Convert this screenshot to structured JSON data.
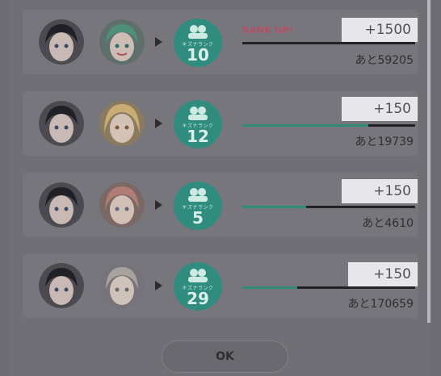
{
  "rows": [
    {
      "rank_up": "RANK UP!",
      "gain": "+1500",
      "remaining": "あと59205",
      "rank_label": "キズナランク",
      "rank": "10",
      "progress": 0.0,
      "partner": "green-hair-character"
    },
    {
      "rank_up": "",
      "gain": "+150",
      "remaining": "あと19739",
      "rank_label": "キズナランク",
      "rank": "12",
      "progress": 0.73,
      "partner": "blonde-hair-character"
    },
    {
      "rank_up": "",
      "gain": "+150",
      "remaining": "あと4610",
      "rank_label": "キズナランク",
      "rank": "5",
      "progress": 0.37,
      "partner": "pink-hair-character"
    },
    {
      "rank_up": "",
      "gain": "+150",
      "remaining": "あと170659",
      "rank_label": "キズナランク",
      "rank": "29",
      "progress": 0.32,
      "partner": "silver-hair-character"
    }
  ],
  "ok_button": "OK",
  "colors": {
    "badge": "#2f8c7f",
    "progress": "#2f8a77",
    "rank_up": "#b84e66"
  }
}
